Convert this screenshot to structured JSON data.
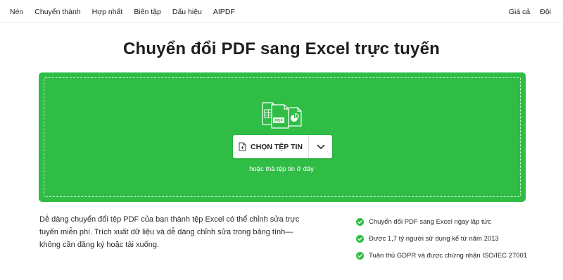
{
  "nav": {
    "left": [
      "Nén",
      "Chuyển thành",
      "Hợp nhất",
      "Biên tập",
      "Dấu hiệu",
      "AIPDF"
    ],
    "right": [
      "Giá cả",
      "Đội"
    ]
  },
  "title": "Chuyển đổi PDF sang Excel trực tuyến",
  "upload": {
    "pdf_badge": "PDF",
    "choose_label": "CHỌN TỆP TIN",
    "drop_hint": "hoặc thả tệp tin ở đây",
    "dropdown_icon": "chevron-down-icon",
    "file_icon": "pdf-excel-file-icon"
  },
  "description": "Dễ dàng chuyển đổi tệp PDF của bạn thành tệp Excel có thể chỉnh sửa trực tuyến miễn phí. Trích xuất dữ liệu và dễ dàng chỉnh sửa trong bảng tính—không cần đăng ký hoặc tải xuống.",
  "features": [
    "Chuyển đổi PDF sang Excel ngay lập tức",
    "Được 1,7 tỷ người sử dụng kể từ năm 2013",
    "Tuân thủ GDPR và được chứng nhận ISO/IEC 27001"
  ],
  "colors": {
    "accent": "#2fbd45",
    "check": "#2fbd45"
  }
}
